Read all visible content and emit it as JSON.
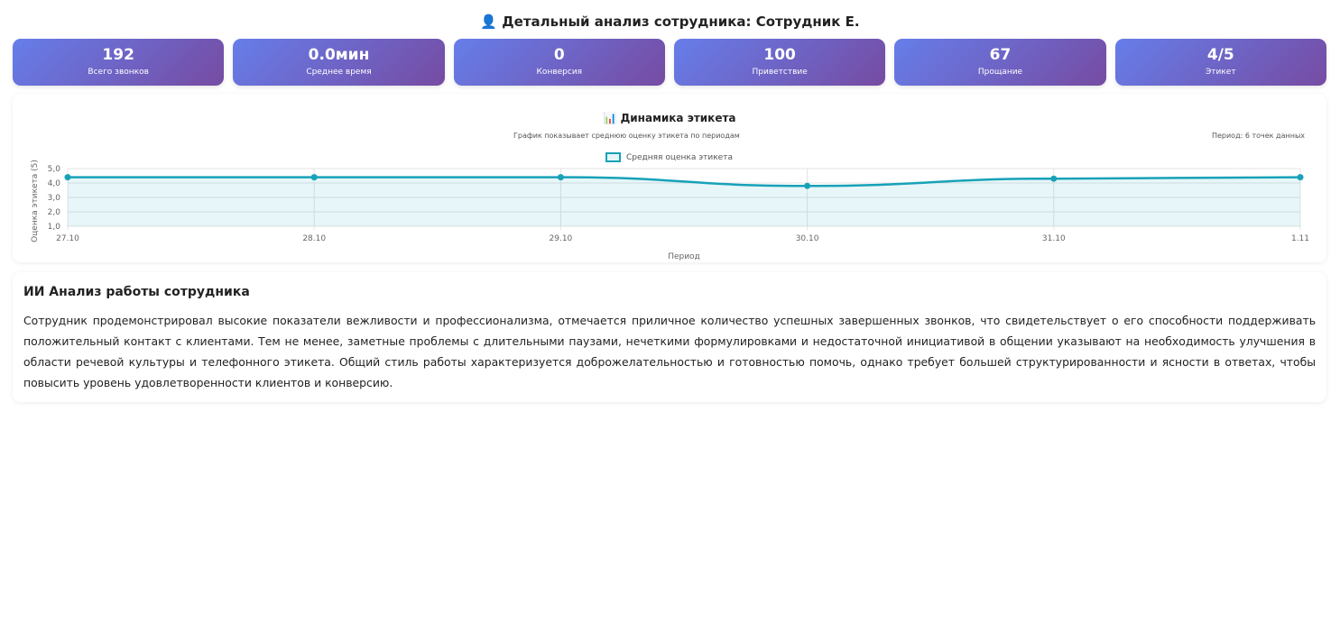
{
  "header": {
    "icon": "person-icon",
    "title": "👤 Детальный анализ сотрудника: Сотрудник Е."
  },
  "stats": [
    {
      "value": "192",
      "label": "Всего звонков"
    },
    {
      "value": "0.0мин",
      "label": "Среднее время"
    },
    {
      "value": "0",
      "label": "Конверсия"
    },
    {
      "value": "100",
      "label": "Приветствие"
    },
    {
      "value": "67",
      "label": "Прощание"
    },
    {
      "value": "4/5",
      "label": "Этикет"
    }
  ],
  "chart_data": {
    "type": "line",
    "title": "📊 Динамика этикета",
    "subtitle": "График показывает среднюю оценку этикета по периодам",
    "period_note": "Период: 6 точек данных",
    "categories": [
      "27.10",
      "28.10",
      "29.10",
      "30.10",
      "31.10",
      "1.11"
    ],
    "series": [
      {
        "name": "Средняя оценка этикета",
        "values": [
          4.4,
          4.4,
          4.4,
          3.8,
          4.3,
          4.4
        ],
        "color": "#17a2b8"
      }
    ],
    "xlabel": "Период",
    "ylabel": "Оценка этикета (5)",
    "ylim": [
      1,
      5
    ],
    "yticks": [
      "1,0",
      "2,0",
      "3,0",
      "4,0",
      "5,0"
    ],
    "grid": true,
    "legend": "top"
  },
  "ai": {
    "title": "ИИ Анализ работы сотрудника",
    "text": "Сотрудник продемонстрировал высокие показатели вежливости и профессионализма, отмечается приличное количество успешных завершенных звонков, что свидетельствует о его способности поддерживать положительный контакт с клиентами. Тем не менее, заметные проблемы с длительными паузами, нечеткими формулировками и недостаточной инициативой в общении указывают на необходимость улучшения в области речевой культуры и телефонного этикета. Общий стиль работы характеризуется доброжелательностью и готовностью помочь, однако требует большей структурированности и ясности в ответах, чтобы повысить уровень удовлетворенности клиентов и конверсию."
  }
}
